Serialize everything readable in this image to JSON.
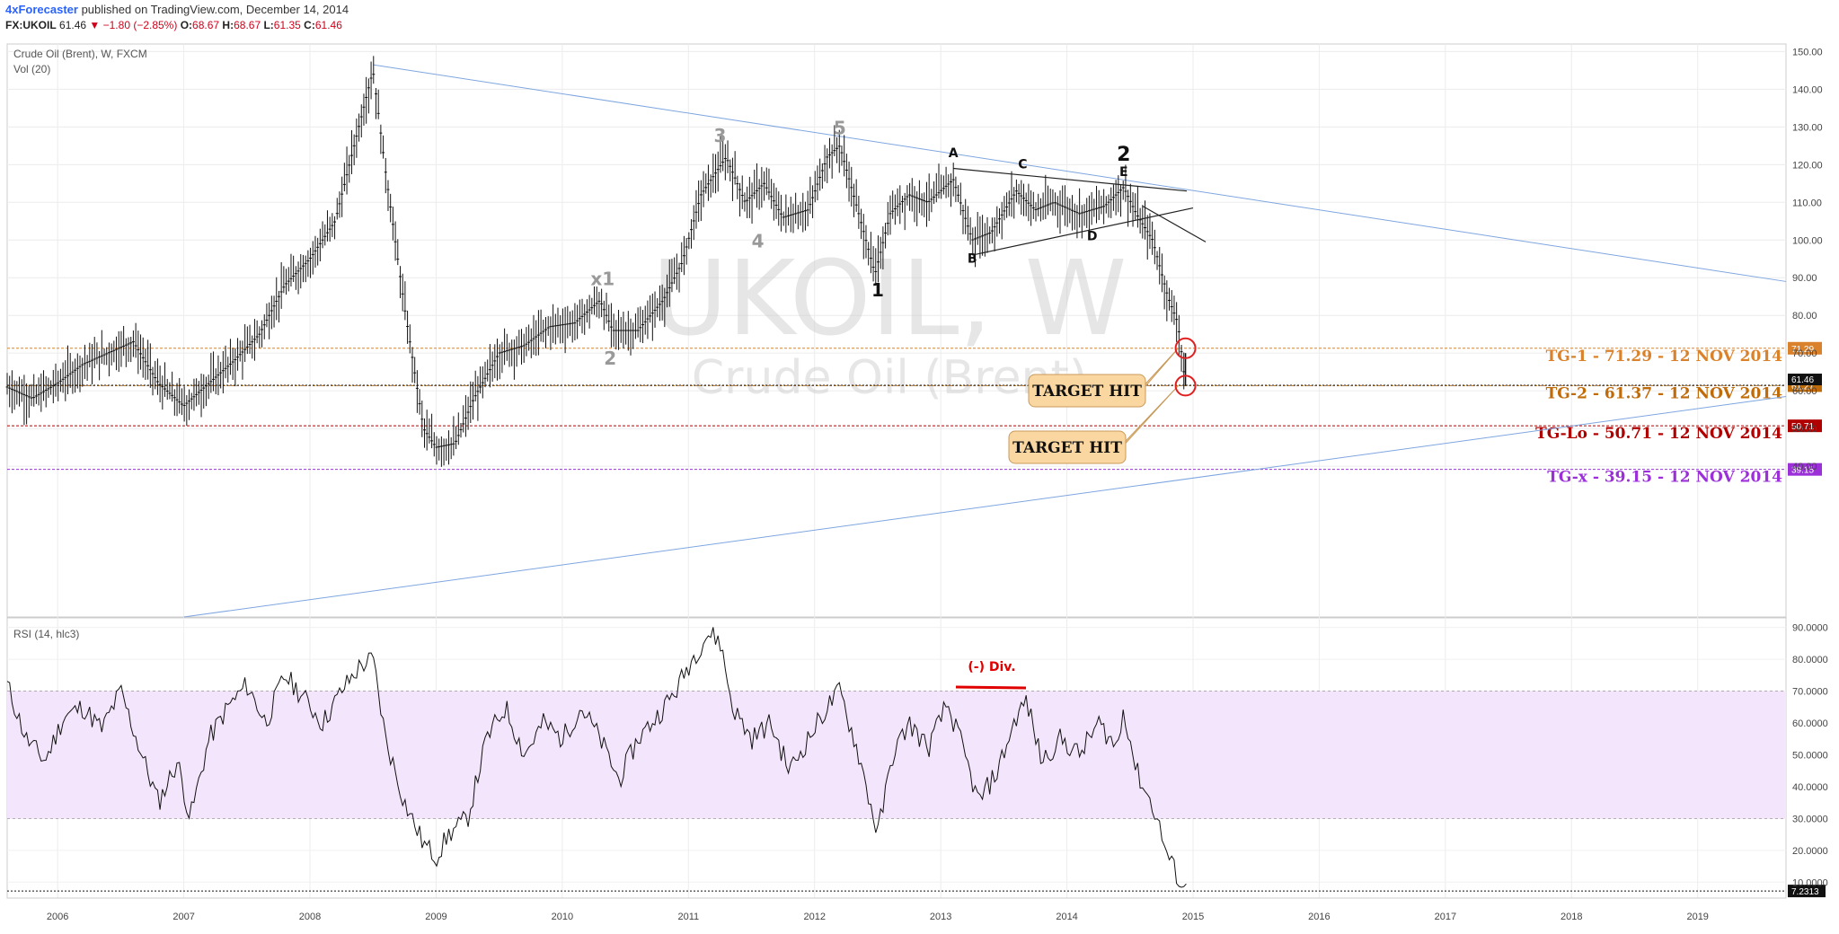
{
  "header": {
    "author": "4xForecaster",
    "published": "published on TradingView.com, December 14, 2014",
    "symbol": "FX:UKOIL",
    "last": "61.46",
    "change": "−1.80 (−2.85%)",
    "o_label": "O:",
    "open": "68.67",
    "h_label": "H:",
    "high": "68.67",
    "l_label": "L:",
    "low": "61.35",
    "c_label": "C:",
    "close": "61.46"
  },
  "main_pane": {
    "title": "Crude Oil (Brent), W, FXCM",
    "vol_label": "Vol (20)",
    "watermark_symbol": "UKOIL, W",
    "watermark_name": "Crude Oil (Brent)"
  },
  "rsi_pane": {
    "title": "RSI (14, hlc3)",
    "div_label": "(-) Div."
  },
  "colors": {
    "trendline": "#7ea6e0",
    "candles": "#111111",
    "tg1": "#d9822b",
    "tg2": "#c06b0a",
    "tglo": "#b00000",
    "tgx": "#9b30d9",
    "rsi_band": "#f3e5fb",
    "callout": "#fad7a0",
    "circle": "#e02020"
  },
  "chart_data": [
    {
      "type": "candlestick",
      "title": "Crude Oil (Brent), W, FXCM",
      "x_ticks": [
        "2006",
        "2007",
        "2008",
        "2009",
        "2010",
        "2011",
        "2012",
        "2013",
        "2014",
        "2015",
        "2016",
        "2017",
        "2018",
        "2019"
      ],
      "x_range": [
        2005.6,
        2019.7
      ],
      "ylim": [
        0,
        152
      ],
      "y_ticks": [
        "40.00",
        "50.00",
        "60.00",
        "70.00",
        "80.00",
        "90.00",
        "100.00",
        "110.00",
        "120.00",
        "130.00",
        "140.00",
        "150.00"
      ],
      "close_series": [
        {
          "t": 2005.6,
          "v": 61
        },
        {
          "t": 2005.8,
          "v": 58
        },
        {
          "t": 2006.0,
          "v": 62
        },
        {
          "t": 2006.2,
          "v": 67
        },
        {
          "t": 2006.4,
          "v": 70
        },
        {
          "t": 2006.6,
          "v": 73
        },
        {
          "t": 2006.8,
          "v": 62
        },
        {
          "t": 2007.0,
          "v": 56
        },
        {
          "t": 2007.2,
          "v": 62
        },
        {
          "t": 2007.4,
          "v": 68
        },
        {
          "t": 2007.6,
          "v": 75
        },
        {
          "t": 2007.8,
          "v": 88
        },
        {
          "t": 2008.0,
          "v": 95
        },
        {
          "t": 2008.2,
          "v": 105
        },
        {
          "t": 2008.35,
          "v": 125
        },
        {
          "t": 2008.5,
          "v": 145
        },
        {
          "t": 2008.6,
          "v": 118
        },
        {
          "t": 2008.75,
          "v": 82
        },
        {
          "t": 2008.9,
          "v": 50
        },
        {
          "t": 2009.0,
          "v": 45
        },
        {
          "t": 2009.15,
          "v": 46
        },
        {
          "t": 2009.3,
          "v": 58
        },
        {
          "t": 2009.5,
          "v": 70
        },
        {
          "t": 2009.7,
          "v": 72
        },
        {
          "t": 2009.9,
          "v": 77
        },
        {
          "t": 2010.1,
          "v": 78
        },
        {
          "t": 2010.3,
          "v": 84
        },
        {
          "t": 2010.4,
          "v": 76
        },
        {
          "t": 2010.6,
          "v": 76
        },
        {
          "t": 2010.8,
          "v": 84
        },
        {
          "t": 2010.95,
          "v": 94
        },
        {
          "t": 2011.1,
          "v": 112
        },
        {
          "t": 2011.3,
          "v": 122
        },
        {
          "t": 2011.45,
          "v": 110
        },
        {
          "t": 2011.6,
          "v": 115
        },
        {
          "t": 2011.75,
          "v": 106
        },
        {
          "t": 2011.95,
          "v": 108
        },
        {
          "t": 2012.1,
          "v": 122
        },
        {
          "t": 2012.2,
          "v": 125
        },
        {
          "t": 2012.35,
          "v": 107
        },
        {
          "t": 2012.48,
          "v": 91
        },
        {
          "t": 2012.6,
          "v": 107
        },
        {
          "t": 2012.75,
          "v": 112
        },
        {
          "t": 2012.9,
          "v": 110
        },
        {
          "t": 2013.1,
          "v": 116
        },
        {
          "t": 2013.25,
          "v": 100
        },
        {
          "t": 2013.4,
          "v": 102
        },
        {
          "t": 2013.6,
          "v": 113
        },
        {
          "t": 2013.75,
          "v": 108
        },
        {
          "t": 2013.9,
          "v": 110
        },
        {
          "t": 2014.1,
          "v": 107
        },
        {
          "t": 2014.3,
          "v": 109
        },
        {
          "t": 2014.45,
          "v": 114
        },
        {
          "t": 2014.55,
          "v": 107
        },
        {
          "t": 2014.68,
          "v": 100
        },
        {
          "t": 2014.8,
          "v": 85
        },
        {
          "t": 2014.88,
          "v": 78
        },
        {
          "t": 2014.94,
          "v": 61.46
        }
      ],
      "volume_label": "Vol (20)",
      "wave_labels": [
        {
          "text": "3",
          "t": 2011.25,
          "v": 126,
          "color": "gray"
        },
        {
          "text": "5",
          "t": 2012.2,
          "v": 128,
          "color": "gray"
        },
        {
          "text": "x1",
          "t": 2010.32,
          "v": 88,
          "color": "gray"
        },
        {
          "text": "4",
          "t": 2011.55,
          "v": 98,
          "color": "gray"
        },
        {
          "text": "2",
          "t": 2010.38,
          "v": 67,
          "color": "gray"
        },
        {
          "text": "1",
          "t": 2012.5,
          "v": 85,
          "color": "black"
        },
        {
          "text": "A",
          "t": 2013.1,
          "v": 122,
          "color": "black"
        },
        {
          "text": "C",
          "t": 2013.65,
          "v": 119,
          "color": "black"
        },
        {
          "text": "2",
          "t": 2014.45,
          "v": 121,
          "color": "black"
        },
        {
          "text": "E",
          "t": 2014.45,
          "v": 117,
          "color": "black"
        },
        {
          "text": "B",
          "t": 2013.25,
          "v": 94,
          "color": "black"
        },
        {
          "text": "D",
          "t": 2014.2,
          "v": 100,
          "color": "black"
        }
      ],
      "targets": [
        {
          "label": "TG-1 - 71.29 - 12 NOV 2014",
          "value": 71.29,
          "axis_label": "71.29",
          "color": "#d9822b"
        },
        {
          "label": "TG-2 - 61.37 - 12 NOV 2014",
          "value": 61.37,
          "axis_label": "61.27",
          "color": "#c06b0a"
        },
        {
          "label": "TG-Lo - 50.71 - 12 NOV 2014",
          "value": 50.71,
          "axis_label": "50.71",
          "color": "#b00000"
        },
        {
          "label": "TG-x - 39.15 - 12 NOV 2014",
          "value": 39.15,
          "axis_label": "39.15",
          "color": "#9b30d9"
        }
      ],
      "last_price_label": "61.46",
      "callouts": [
        "TARGET HIT",
        "TARGET HIT"
      ]
    },
    {
      "type": "line",
      "title": "RSI (14, hlc3)",
      "ylim": [
        5,
        93
      ],
      "y_ticks": [
        "10.0000",
        "20.0000",
        "30.0000",
        "40.0000",
        "50.0000",
        "60.0000",
        "70.0000",
        "80.0000",
        "90.0000"
      ],
      "bands": [
        30,
        70
      ],
      "last_value_label": "7.2313",
      "series": [
        {
          "t": 2005.6,
          "v": 72
        },
        {
          "t": 2005.75,
          "v": 55
        },
        {
          "t": 2005.9,
          "v": 48
        },
        {
          "t": 2006.05,
          "v": 62
        },
        {
          "t": 2006.2,
          "v": 65
        },
        {
          "t": 2006.35,
          "v": 58
        },
        {
          "t": 2006.5,
          "v": 70
        },
        {
          "t": 2006.65,
          "v": 52
        },
        {
          "t": 2006.8,
          "v": 35
        },
        {
          "t": 2006.95,
          "v": 48
        },
        {
          "t": 2007.05,
          "v": 30
        },
        {
          "t": 2007.2,
          "v": 55
        },
        {
          "t": 2007.35,
          "v": 65
        },
        {
          "t": 2007.5,
          "v": 72
        },
        {
          "t": 2007.65,
          "v": 60
        },
        {
          "t": 2007.8,
          "v": 75
        },
        {
          "t": 2007.95,
          "v": 68
        },
        {
          "t": 2008.1,
          "v": 60
        },
        {
          "t": 2008.25,
          "v": 70
        },
        {
          "t": 2008.4,
          "v": 78
        },
        {
          "t": 2008.5,
          "v": 80
        },
        {
          "t": 2008.6,
          "v": 55
        },
        {
          "t": 2008.75,
          "v": 35
        },
        {
          "t": 2008.9,
          "v": 22
        },
        {
          "t": 2009.0,
          "v": 18
        },
        {
          "t": 2009.1,
          "v": 25
        },
        {
          "t": 2009.25,
          "v": 30
        },
        {
          "t": 2009.4,
          "v": 55
        },
        {
          "t": 2009.55,
          "v": 65
        },
        {
          "t": 2009.7,
          "v": 50
        },
        {
          "t": 2009.85,
          "v": 60
        },
        {
          "t": 2010.0,
          "v": 55
        },
        {
          "t": 2010.15,
          "v": 65
        },
        {
          "t": 2010.3,
          "v": 55
        },
        {
          "t": 2010.45,
          "v": 42
        },
        {
          "t": 2010.6,
          "v": 55
        },
        {
          "t": 2010.75,
          "v": 62
        },
        {
          "t": 2010.9,
          "v": 70
        },
        {
          "t": 2011.0,
          "v": 78
        },
        {
          "t": 2011.15,
          "v": 88
        },
        {
          "t": 2011.25,
          "v": 86
        },
        {
          "t": 2011.35,
          "v": 65
        },
        {
          "t": 2011.5,
          "v": 55
        },
        {
          "t": 2011.65,
          "v": 60
        },
        {
          "t": 2011.8,
          "v": 45
        },
        {
          "t": 2011.95,
          "v": 55
        },
        {
          "t": 2012.1,
          "v": 65
        },
        {
          "t": 2012.2,
          "v": 70
        },
        {
          "t": 2012.35,
          "v": 50
        },
        {
          "t": 2012.5,
          "v": 25
        },
        {
          "t": 2012.62,
          "v": 50
        },
        {
          "t": 2012.75,
          "v": 60
        },
        {
          "t": 2012.9,
          "v": 52
        },
        {
          "t": 2013.05,
          "v": 66
        },
        {
          "t": 2013.15,
          "v": 55
        },
        {
          "t": 2013.3,
          "v": 35
        },
        {
          "t": 2013.45,
          "v": 45
        },
        {
          "t": 2013.6,
          "v": 62
        },
        {
          "t": 2013.68,
          "v": 67
        },
        {
          "t": 2013.8,
          "v": 48
        },
        {
          "t": 2013.95,
          "v": 55
        },
        {
          "t": 2014.1,
          "v": 50
        },
        {
          "t": 2014.25,
          "v": 60
        },
        {
          "t": 2014.4,
          "v": 52
        },
        {
          "t": 2014.45,
          "v": 65
        },
        {
          "t": 2014.55,
          "v": 45
        },
        {
          "t": 2014.7,
          "v": 32
        },
        {
          "t": 2014.8,
          "v": 18
        },
        {
          "t": 2014.9,
          "v": 10
        },
        {
          "t": 2014.95,
          "v": 7.23
        }
      ]
    }
  ]
}
